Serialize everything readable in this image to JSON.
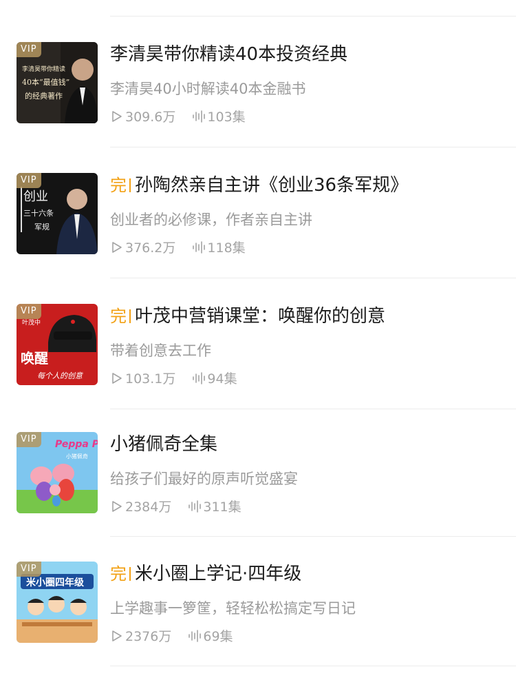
{
  "items": [
    {
      "title": "李清昊带你精读40本投资经典",
      "finished": false,
      "subtitle": "李清昊40小时解读40本金融书",
      "plays": "309.6万",
      "episodes": "103集",
      "vip": "VIP",
      "cover": {
        "lines": [
          "李清昊带你精读",
          "40本“最值钱”",
          "的经典著作"
        ]
      }
    },
    {
      "title": "孙陶然亲自主讲《创业36条军规》",
      "finished": true,
      "finished_label": "完",
      "subtitle": "创业者的必修课，作者亲自主讲",
      "plays": "376.2万",
      "episodes": "118集",
      "vip": "VIP",
      "cover": {
        "lines": [
          "创业",
          "三十六条",
          "军规"
        ]
      }
    },
    {
      "title": "叶茂中营销课堂：唤醒你的创意",
      "finished": true,
      "finished_label": "完",
      "subtitle": "带着创意去工作",
      "plays": "103.1万",
      "episodes": "94集",
      "vip": "VIP",
      "cover": {
        "lines": [
          "叶茂中",
          "唤醒",
          "每个人的创意"
        ]
      }
    },
    {
      "title": "小猪佩奇全集",
      "finished": false,
      "subtitle": "给孩子们最好的原声听觉盛宴",
      "plays": "2384万",
      "episodes": "311集",
      "vip": "VIP",
      "cover": {
        "lines": [
          "Peppa Pig",
          "小猪佩奇"
        ]
      }
    },
    {
      "title": "米小圈上学记·四年级",
      "finished": true,
      "finished_label": "完",
      "subtitle": "上学趣事一箩筐，轻轻松松搞定写日记",
      "plays": "2376万",
      "episodes": "69集",
      "vip": "VIP",
      "cover": {
        "lines": [
          "米小圈四年级"
        ]
      }
    }
  ],
  "colors": {
    "accent": "#f2a115",
    "meta": "#a4a4a4",
    "title": "#1c1c1c"
  }
}
